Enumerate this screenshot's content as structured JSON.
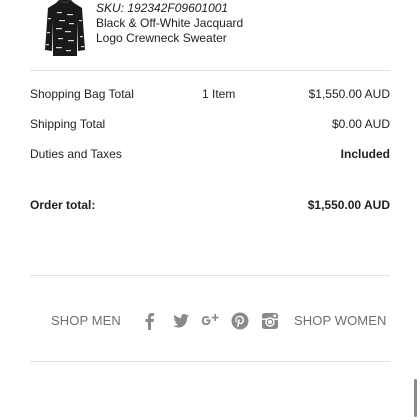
{
  "product": {
    "sku_label": "SKU: 192342F09601001",
    "name_line1": "Black & Off-White Jacquard",
    "name_line2": "Logo Crewneck Sweater",
    "thumbnail_icon": "sweater-thumbnail"
  },
  "summary": {
    "bag_total_label": "Shopping Bag Total",
    "bag_item_count": "1 Item",
    "bag_total_value": "$1,550.00 AUD",
    "shipping_label": "Shipping Total",
    "shipping_value": "$0.00 AUD",
    "duties_label": "Duties and Taxes",
    "duties_value": "Included",
    "order_total_label": "Order total:",
    "order_total_value": "$1,550.00 AUD"
  },
  "footer": {
    "shop_men": "SHOP MEN",
    "shop_women": "SHOP WOMEN",
    "social_icons": [
      "facebook-icon",
      "twitter-icon",
      "google-plus-icon",
      "pinterest-icon",
      "instagram-icon"
    ],
    "icon_color": "#8a8a8a"
  }
}
